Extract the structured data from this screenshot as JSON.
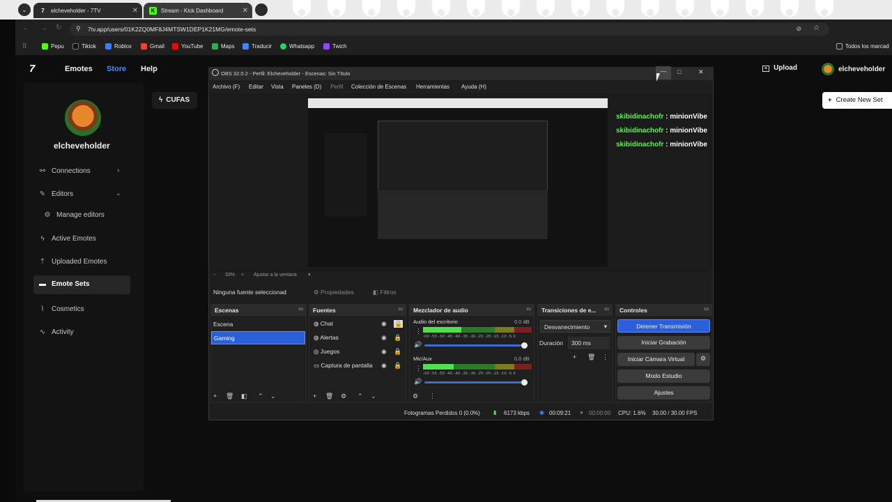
{
  "browser": {
    "tabs": [
      {
        "title": "elcheveholder - 7TV",
        "favicon": "7"
      },
      {
        "title": "Stream - Kick Dashboard",
        "favicon": "K"
      }
    ],
    "url": "7tv.app/users/01K2ZQ0MF8J4MTSW1DEP1K21MG/emote-sets",
    "bookmarks": [
      "Pepu",
      "Tiktok",
      "Roblox",
      "Gmail",
      "YouTube",
      "Maps",
      "Traducir",
      "Whatsapp",
      "Twich"
    ],
    "all_bookmarks": "Todos los marcad"
  },
  "site": {
    "nav": {
      "emotes": "Emotes",
      "store": "Store",
      "help": "Help"
    },
    "upload": "Upload",
    "username": "elcheveholder",
    "cufas": "CUFAS",
    "create_set": "Create New Set",
    "profile_name": "elcheveholder",
    "sidebar": [
      {
        "label": "Connections",
        "icon": "link-icon"
      },
      {
        "label": "Editors",
        "icon": "pencil-icon"
      },
      {
        "label": "Manage editors",
        "icon": "gear-icon"
      },
      {
        "label": "Active Emotes",
        "icon": "lightning-icon"
      },
      {
        "label": "Uploaded Emotes",
        "icon": "upload-icon"
      },
      {
        "label": "Emote Sets",
        "icon": "folder-icon"
      },
      {
        "label": "Cosmetics",
        "icon": "brush-icon"
      },
      {
        "label": "Activity",
        "icon": "activity-icon"
      }
    ]
  },
  "obs": {
    "title": "OBS 32.0.2 - Perfil: Elcheveholder - Escenas: Sin Título",
    "menu": [
      "Archivo (F)",
      "Editar",
      "Vista",
      "Paneles (D)",
      "Perfil",
      "Colección de Escenas",
      "Herramientas",
      "Ayuda (H)"
    ],
    "chat": [
      {
        "user": "skibidinachofr",
        "msg": "minionVibe"
      },
      {
        "user": "skibidinachofr",
        "msg": "minionVibe"
      },
      {
        "user": "skibidinachofr",
        "msg": "minionVibe"
      }
    ],
    "zoom": "33%",
    "fit": "Ajustar a la ventana",
    "no_source": "Ninguna fuente seleccionad",
    "properties": "Propiedades",
    "filters": "Filtros",
    "docks": {
      "scenes": "Escenas",
      "sources": "Fuentes",
      "mixer": "Mezclador de audio",
      "transitions": "Transiciones de e...",
      "controls": "Controles"
    },
    "scenes": [
      "Escena",
      "Gaming"
    ],
    "sources": [
      "Chat",
      "Alertas",
      "Juegos",
      "Captura de pantalla"
    ],
    "mixer": [
      {
        "name": "Audio del escritorio",
        "db": "0.0 dB",
        "level": 0.35
      },
      {
        "name": "Mic/Aux",
        "db": "0.0 dB",
        "level": 0.28
      }
    ],
    "mixer_scale": "-60 -55 -50 -45 -40 -35 -30 -25 -20 -15 -10 -5 0",
    "transition": "Desvanecimiento",
    "duration_label": "Duración",
    "duration": "300 ms",
    "controls": [
      "Detener Transmisión",
      "Iniciar Grabación",
      "Iniciar Cámara Virtual",
      "Modo Estudio",
      "Ajustes"
    ],
    "status": {
      "dropped": "Fotogramas Perdidos 0 (0.0%)",
      "kbps": "6173 kbps",
      "stream_time": "00:09:21",
      "rec_time": "00:00:00",
      "cpu": "CPU: 1.6%",
      "fps": "30.00 / 30.00 FPS"
    }
  },
  "colors": {
    "accent": "#2a5fd9",
    "store": "#3b8cff",
    "meter_green": "#4ee04e"
  }
}
